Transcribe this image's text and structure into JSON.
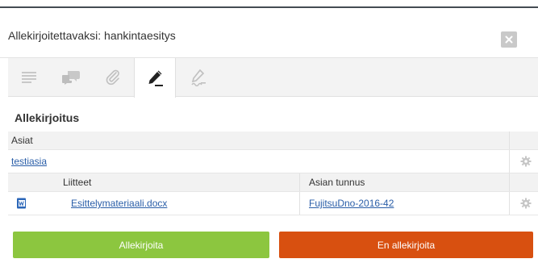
{
  "dialog": {
    "title": "Allekirjoitettavaksi: hankintaesitys"
  },
  "toolbar": {
    "tools": [
      {
        "name": "text-lines-icon",
        "active": false
      },
      {
        "name": "comments-icon",
        "active": false
      },
      {
        "name": "attachment-icon",
        "active": false
      },
      {
        "name": "sign-pen-icon",
        "active": true
      },
      {
        "name": "signed-document-icon",
        "active": false
      }
    ]
  },
  "section": {
    "title": "Allekirjoitus"
  },
  "table": {
    "header": "Asiat",
    "case": {
      "link": "testiasia"
    },
    "columns": {
      "attachments": "Liitteet",
      "case_id": "Asian tunnus"
    },
    "attachment": {
      "icon": "word-document-icon",
      "file": "Esittelymateriaali.docx",
      "case_id": "FujitsuDno-2016-42"
    }
  },
  "actions": {
    "sign_label": "Allekirjoita",
    "decline_label": "En allekirjoita"
  },
  "colors": {
    "sign_button": "#8cc63f",
    "decline_button": "#d85010",
    "link": "#2a5ea8",
    "top_border": "#444b53"
  }
}
